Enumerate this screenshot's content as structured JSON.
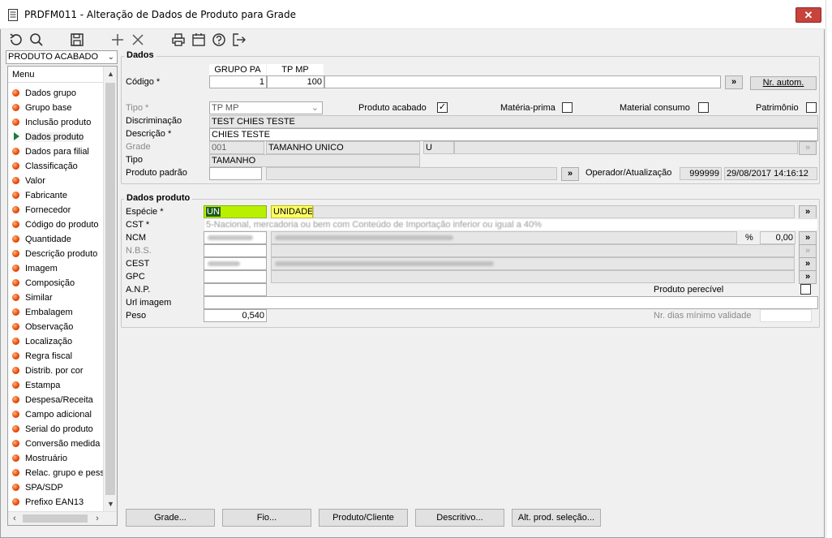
{
  "window": {
    "title": "PRDFM011 - Alteração de Dados de Produto para Grade",
    "close_glyph": "✕"
  },
  "toolbar": {
    "icons": [
      "refresh-icon",
      "search-icon",
      "save-icon",
      "add-icon",
      "delete-icon",
      "print-icon",
      "calendar-icon",
      "help-icon",
      "exit-icon"
    ]
  },
  "left": {
    "combo_value": "PRODUTO ACABADO",
    "menu_header": "Menu",
    "items": [
      "Dados grupo",
      "Grupo base",
      "Inclusão produto",
      "Dados produto",
      "Dados para filial",
      "Classificação",
      "Valor",
      "Fabricante",
      "Fornecedor",
      "Código do produto",
      "Quantidade",
      "Descrição produto",
      "Imagem",
      "Composição",
      "Similar",
      "Embalagem",
      "Observação",
      "Localização",
      "Regra fiscal",
      "Distrib. por cor",
      "Estampa",
      "Despesa/Receita",
      "Campo adicional",
      "Serial do produto",
      "Conversão medida",
      "Mostruário",
      "Relac. grupo e pess",
      "SPA/SDP",
      "Prefixo EAN13"
    ]
  },
  "dados": {
    "title": "Dados",
    "codigo_label": "Código *",
    "col_grupo_pa": "GRUPO PA",
    "col_tp_mp": "TP MP",
    "grupo_pa_value": "1",
    "tp_mp_value": "100",
    "nr_autom_label": "Nr. autom.",
    "arrow_label": "»",
    "tipo_label": "Tipo *",
    "tipo_value": "TP MP",
    "produto_acabado_label": "Produto acabado",
    "materia_prima_label": "Matéria-prima",
    "material_consumo_label": "Material consumo",
    "patrimonio_label": "Patrimônio",
    "check_mark": "✓",
    "discriminacao_label": "Discriminação",
    "discriminacao_value": "TEST CHIES TESTE",
    "descricao_label": "Descrição *",
    "descricao_value": "CHIES TESTE",
    "grade_label": "Grade",
    "grade_code": "001",
    "grade_desc": "TAMANHO UNICO",
    "grade_extra": "U",
    "tipo2_label": "Tipo",
    "tipo2_value": "TAMANHO",
    "produto_padrao_label": "Produto padrão",
    "operador_label": "Operador/Atualização",
    "operador_value": "999999",
    "atualizacao_value": "29/08/2017 14:16:12"
  },
  "dados_produto": {
    "title": "Dados produto",
    "especie_label": "Espécie *",
    "especie_code": "UN",
    "especie_desc": "UNIDADE",
    "cst_label": "CST *",
    "cst_value": "5-Nacional, mercadoria ou bem com Conteúdo de Importação inferior ou igual a 40%",
    "ncm_label": "NCM",
    "percent_label": "%",
    "ncm_percent": "0,00",
    "nbs_label": "N.B.S.",
    "cest_label": "CEST",
    "gpc_label": "GPC",
    "anp_label": "A.N.P.",
    "produto_perecivel_label": "Produto perecível",
    "url_imagem_label": "Url imagem",
    "peso_label": "Peso",
    "peso_value": "0,540",
    "nr_dias_label": "Nr. dias mínimo validade"
  },
  "buttons": {
    "grade": "Grade...",
    "fio": "Fio...",
    "produto_cliente": "Produto/Cliente",
    "descritivo": "Descritivo...",
    "alt_prod": "Alt. prod. seleção..."
  },
  "colors": {
    "close": "#c7433b",
    "especie_code_bg": "#b8f000",
    "especie_desc_bg": "#ffff66",
    "menu_dot": "#e84d0e",
    "selected_marker": "#1c7a3c"
  }
}
